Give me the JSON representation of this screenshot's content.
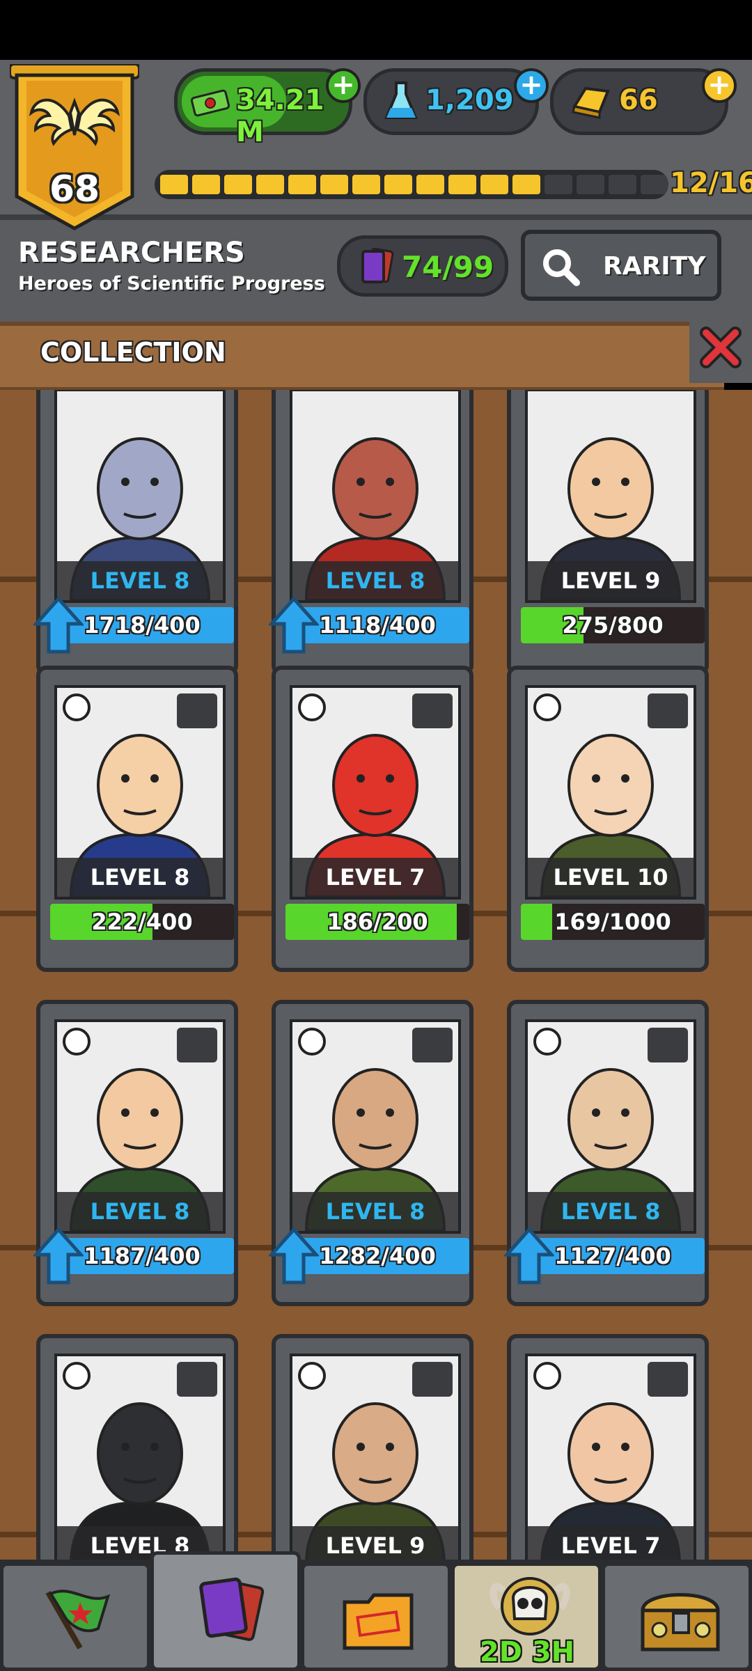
{
  "player": {
    "level": "68"
  },
  "resources": {
    "cash": "34.21 M",
    "flask": "1,209",
    "gold": "66"
  },
  "xp": {
    "text": "12/16",
    "filled": 12,
    "total": 16
  },
  "category": {
    "title": "RESEARCHERS",
    "subtitle": "Heroes of Scientific Progress",
    "cards_count": "74/99",
    "rarity_button": "RARITY"
  },
  "collection_label": "COLLECTION",
  "cards": [
    {
      "level": "LEVEL 8",
      "progress": "1718/400",
      "upgradable": true,
      "fraction": 1.0
    },
    {
      "level": "LEVEL 8",
      "progress": "1118/400",
      "upgradable": true,
      "fraction": 1.0
    },
    {
      "level": "LEVEL 9",
      "progress": "275/800",
      "upgradable": false,
      "fraction": 0.34
    },
    {
      "level": "LEVEL 8",
      "progress": "222/400",
      "upgradable": false,
      "fraction": 0.555
    },
    {
      "level": "LEVEL 7",
      "progress": "186/200",
      "upgradable": false,
      "fraction": 0.93
    },
    {
      "level": "LEVEL 10",
      "progress": "169/1000",
      "upgradable": false,
      "fraction": 0.169
    },
    {
      "level": "LEVEL 8",
      "progress": "1187/400",
      "upgradable": true,
      "fraction": 1.0
    },
    {
      "level": "LEVEL 8",
      "progress": "1282/400",
      "upgradable": true,
      "fraction": 1.0
    },
    {
      "level": "LEVEL 8",
      "progress": "1127/400",
      "upgradable": true,
      "fraction": 1.0
    },
    {
      "level": "LEVEL 8",
      "progress": "",
      "upgradable": false,
      "fraction": 0
    },
    {
      "level": "LEVEL 9",
      "progress": "",
      "upgradable": false,
      "fraction": 0
    },
    {
      "level": "LEVEL 7",
      "progress": "",
      "upgradable": false,
      "fraction": 0
    }
  ],
  "nav": {
    "event_timer": "2D 3H"
  },
  "colors": {
    "level_upgradable": "#2fb6f0",
    "level_normal": "#ffffff",
    "progress_blue": "#2ea6ee",
    "progress_green": "#58d62c",
    "accent_gold": "#f6c52c"
  }
}
